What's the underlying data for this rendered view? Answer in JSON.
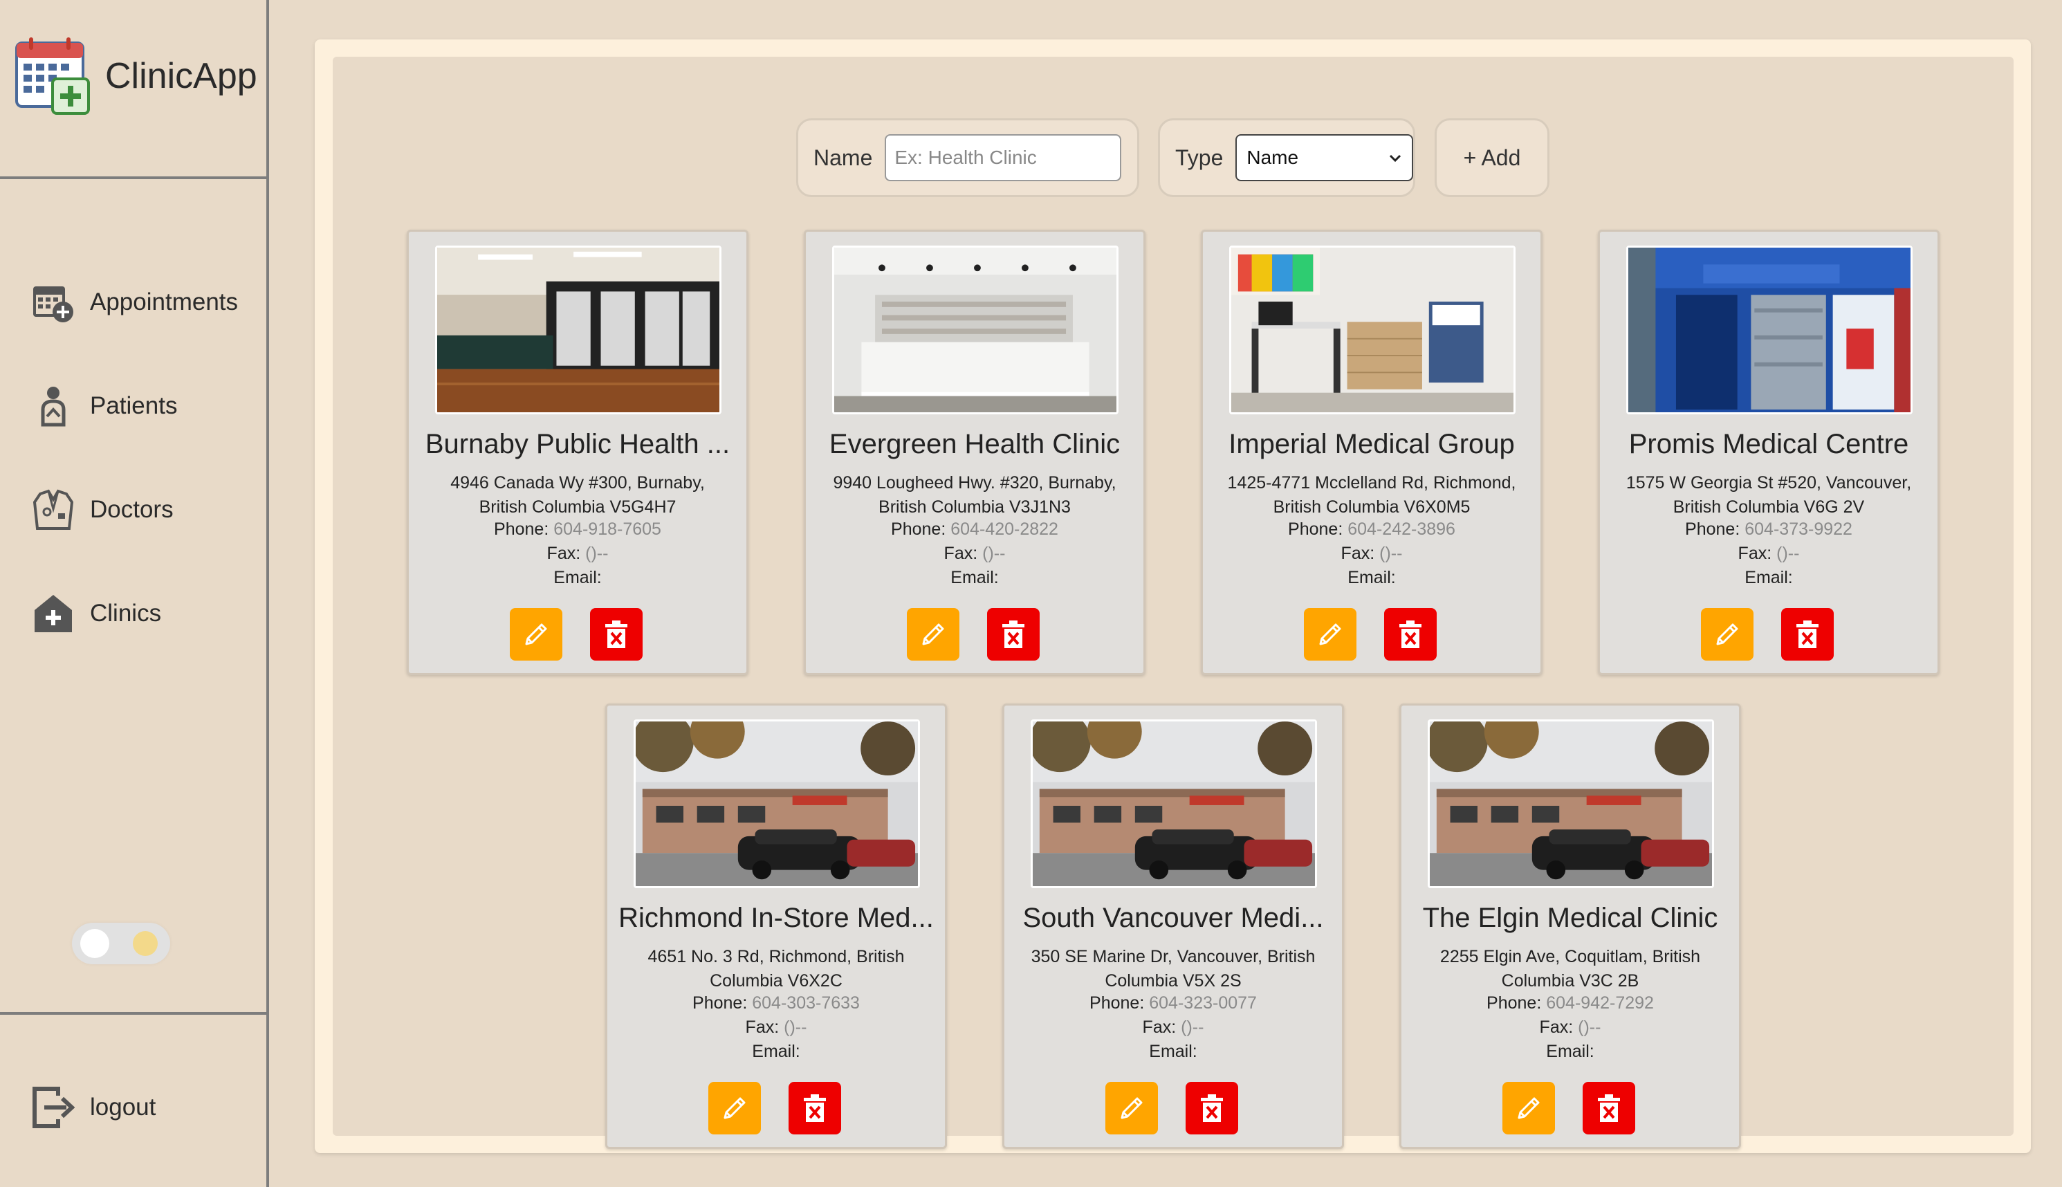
{
  "app": {
    "name": "ClinicApp"
  },
  "nav": [
    {
      "label": "Appointments",
      "icon": "calendar-plus-icon"
    },
    {
      "label": "Patients",
      "icon": "patient-icon"
    },
    {
      "label": "Doctors",
      "icon": "doctor-coat-icon"
    },
    {
      "label": "Clinics",
      "icon": "clinic-icon"
    }
  ],
  "logout": {
    "label": "logout",
    "icon": "logout-icon"
  },
  "theme_toggle": {
    "state": "light"
  },
  "toolbar": {
    "name_label": "Name",
    "name_placeholder": "Ex: Health Clinic",
    "type_label": "Type",
    "type_selected": "Name",
    "add_label": "+ Add"
  },
  "labels": {
    "phone": "Phone:",
    "fax": "Fax:",
    "email": "Email:"
  },
  "clinics": [
    {
      "name": "Burnaby Public Health ...",
      "addr1": "4946 Canada Wy #300, Burnaby,",
      "addr2": "British Columbia V5G4H7",
      "phone": "604-918-7605",
      "fax": "()--",
      "email": "",
      "photo": "interior-reception"
    },
    {
      "name": "Evergreen Health Clinic",
      "addr1": "9940 Lougheed Hwy. #320, Burnaby,",
      "addr2": "British Columbia V3J1N3",
      "phone": "604-420-2822",
      "fax": "()--",
      "email": "",
      "photo": "interior-counter"
    },
    {
      "name": "Imperial Medical Group",
      "addr1": "1425-4771 Mcclelland Rd, Richmond,",
      "addr2": "British Columbia V6X0M5",
      "phone": "604-242-3896",
      "fax": "()--",
      "email": "",
      "photo": "exam-room"
    },
    {
      "name": "Promis Medical Centre",
      "addr1": "1575 W Georgia St #520, Vancouver,",
      "addr2": "British Columbia V6G 2V",
      "phone": "604-373-9922",
      "fax": "()--",
      "email": "",
      "photo": "clinic-entrance"
    },
    {
      "name": "Richmond In-Store Med...",
      "addr1": "4651 No. 3 Rd, Richmond, British",
      "addr2": "Columbia V6X2C",
      "phone": "604-303-7633",
      "fax": "()--",
      "email": "",
      "photo": "storefront"
    },
    {
      "name": "South Vancouver Medi...",
      "addr1": "350 SE Marine Dr, Vancouver, British",
      "addr2": "Columbia V5X 2S",
      "phone": "604-323-0077",
      "fax": "()--",
      "email": "",
      "photo": "storefront"
    },
    {
      "name": "The Elgin Medical Clinic",
      "addr1": "2255 Elgin Ave, Coquitlam, British",
      "addr2": "Columbia V3C 2B",
      "phone": "604-942-7292",
      "fax": "()--",
      "email": "",
      "photo": "storefront"
    }
  ],
  "colors": {
    "edit": "#ffa500",
    "delete": "#ee0000",
    "background": "#e8dac8",
    "panel": "#fdf0dc"
  }
}
